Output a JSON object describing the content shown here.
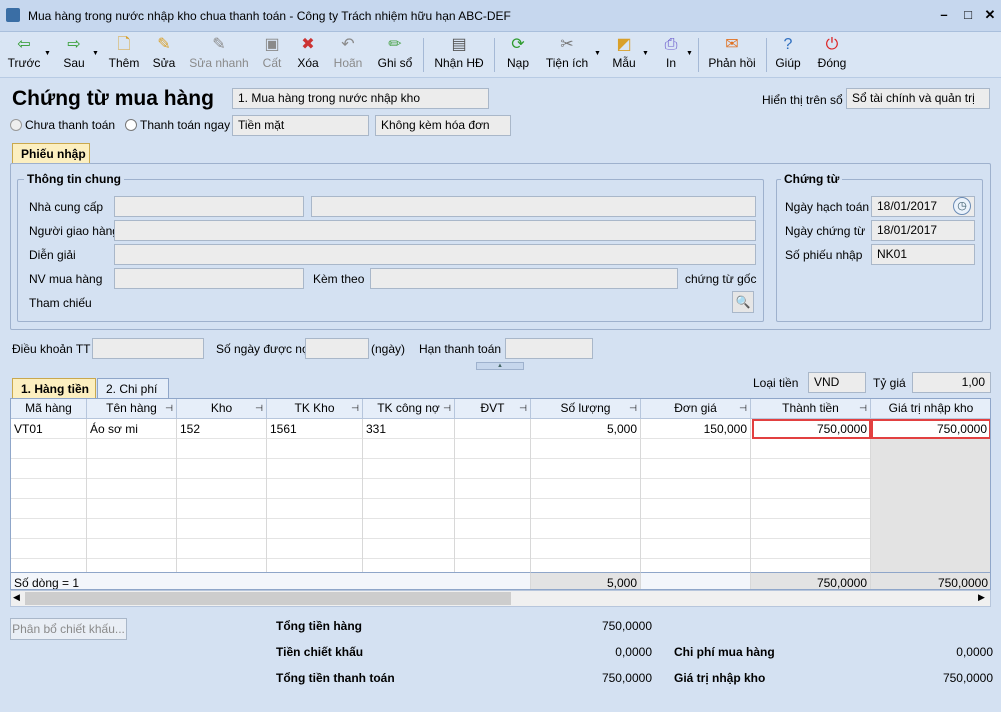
{
  "window": {
    "title": "Mua hàng trong nước nhập kho chua thanh toán - Công ty Trách nhiệm hữu hạn ABC-DEF"
  },
  "toolbar": [
    {
      "id": "truoc",
      "label": "Trước",
      "icon": "arrow-left",
      "disabled": false
    },
    {
      "id": "sau",
      "label": "Sau",
      "icon": "arrow-right",
      "disabled": false
    },
    {
      "id": "them",
      "label": "Thêm",
      "icon": "new-doc",
      "disabled": false
    },
    {
      "id": "sua",
      "label": "Sửa",
      "icon": "edit",
      "disabled": false
    },
    {
      "id": "suanhanh",
      "label": "Sửa nhanh",
      "icon": "quick-edit",
      "disabled": true
    },
    {
      "id": "cat",
      "label": "Cất",
      "icon": "save",
      "disabled": true
    },
    {
      "id": "xoa",
      "label": "Xóa",
      "icon": "delete",
      "disabled": false
    },
    {
      "id": "hoan",
      "label": "Hoãn",
      "icon": "undo",
      "disabled": true
    },
    {
      "id": "ghiso",
      "label": "Ghi sổ",
      "icon": "pencil",
      "disabled": false
    },
    {
      "id": "nhanhd",
      "label": "Nhận HĐ",
      "icon": "invoice",
      "disabled": false
    },
    {
      "id": "nap",
      "label": "Nạp",
      "icon": "refresh",
      "disabled": false
    },
    {
      "id": "tienich",
      "label": "Tiện ích",
      "icon": "tools",
      "disabled": false
    },
    {
      "id": "mau",
      "label": "Mẫu",
      "icon": "template",
      "disabled": false
    },
    {
      "id": "in",
      "label": "In",
      "icon": "print",
      "disabled": false
    },
    {
      "id": "phanhoi",
      "label": "Phản hồi",
      "icon": "mail",
      "disabled": false
    },
    {
      "id": "giup",
      "label": "Giúp",
      "icon": "help",
      "disabled": false
    },
    {
      "id": "dong",
      "label": "Đóng",
      "icon": "power",
      "disabled": false
    }
  ],
  "header": {
    "title": "Chứng từ mua hàng",
    "type": "1. Mua hàng trong nước nhập kho",
    "radio_unpaid": "Chưa thanh toán",
    "radio_paid": "Thanh toán ngay",
    "payment_method": "Tiền mặt",
    "invoice_option": "Không kèm hóa đơn",
    "display_label": "Hiển thị trên sổ",
    "display_value": "Sổ tài chính và quản trị"
  },
  "form_tab": "Phiếu nhập",
  "general": {
    "title": "Thông tin chung",
    "supplier": "Nhà cung cấp",
    "deliverer": "Người giao hàng",
    "description": "Diễn giải",
    "buyer": "NV mua hàng",
    "attach": "Kèm theo",
    "attach_suffix": "chứng từ gốc",
    "reference": "Tham chiếu"
  },
  "voucher": {
    "title": "Chứng từ",
    "posting_date_label": "Ngày hạch toán",
    "posting_date": "18/01/2017",
    "voucher_date_label": "Ngày chứng từ",
    "voucher_date": "18/01/2017",
    "number_label": "Số phiếu nhập",
    "number": "NK01"
  },
  "terms": {
    "terms_label": "Điều khoản TT",
    "days_label": "Số ngày được nợ",
    "days_unit": "(ngày)",
    "due_label": "Hạn thanh toán"
  },
  "detail_tabs": [
    "1. Hàng tiền",
    "2. Chi phí"
  ],
  "currency": {
    "label": "Loại tiền",
    "value": "VND",
    "rate_label": "Tỷ giá",
    "rate": "1,00"
  },
  "grid": {
    "columns": [
      "Mã hàng",
      "Tên hàng",
      "Kho",
      "TK Kho",
      "TK công nợ",
      "ĐVT",
      "Số lượng",
      "Đơn giá",
      "Thành tiền",
      "Giá trị nhập kho"
    ],
    "rows": [
      [
        "VT01",
        "Áo sơ mi",
        "152",
        "1561",
        "331",
        "",
        "5,000",
        "150,000",
        "750,0000",
        "750,0000"
      ]
    ],
    "footer": {
      "count": "Số dòng = 1",
      "qty": "5,000",
      "amount": "750,0000",
      "value": "750,0000"
    }
  },
  "allocate_button": "Phân bổ chiết khấu...",
  "totals": {
    "goods_label": "Tổng tiền hàng",
    "goods": "750,0000",
    "discount_label": "Tiền chiết khấu",
    "discount": "0,0000",
    "payment_label": "Tổng tiền thanh toán",
    "payment": "750,0000",
    "cost_label": "Chi phí mua hàng",
    "cost": "0,0000",
    "import_label": "Giá trị nhập kho",
    "import": "750,0000"
  }
}
